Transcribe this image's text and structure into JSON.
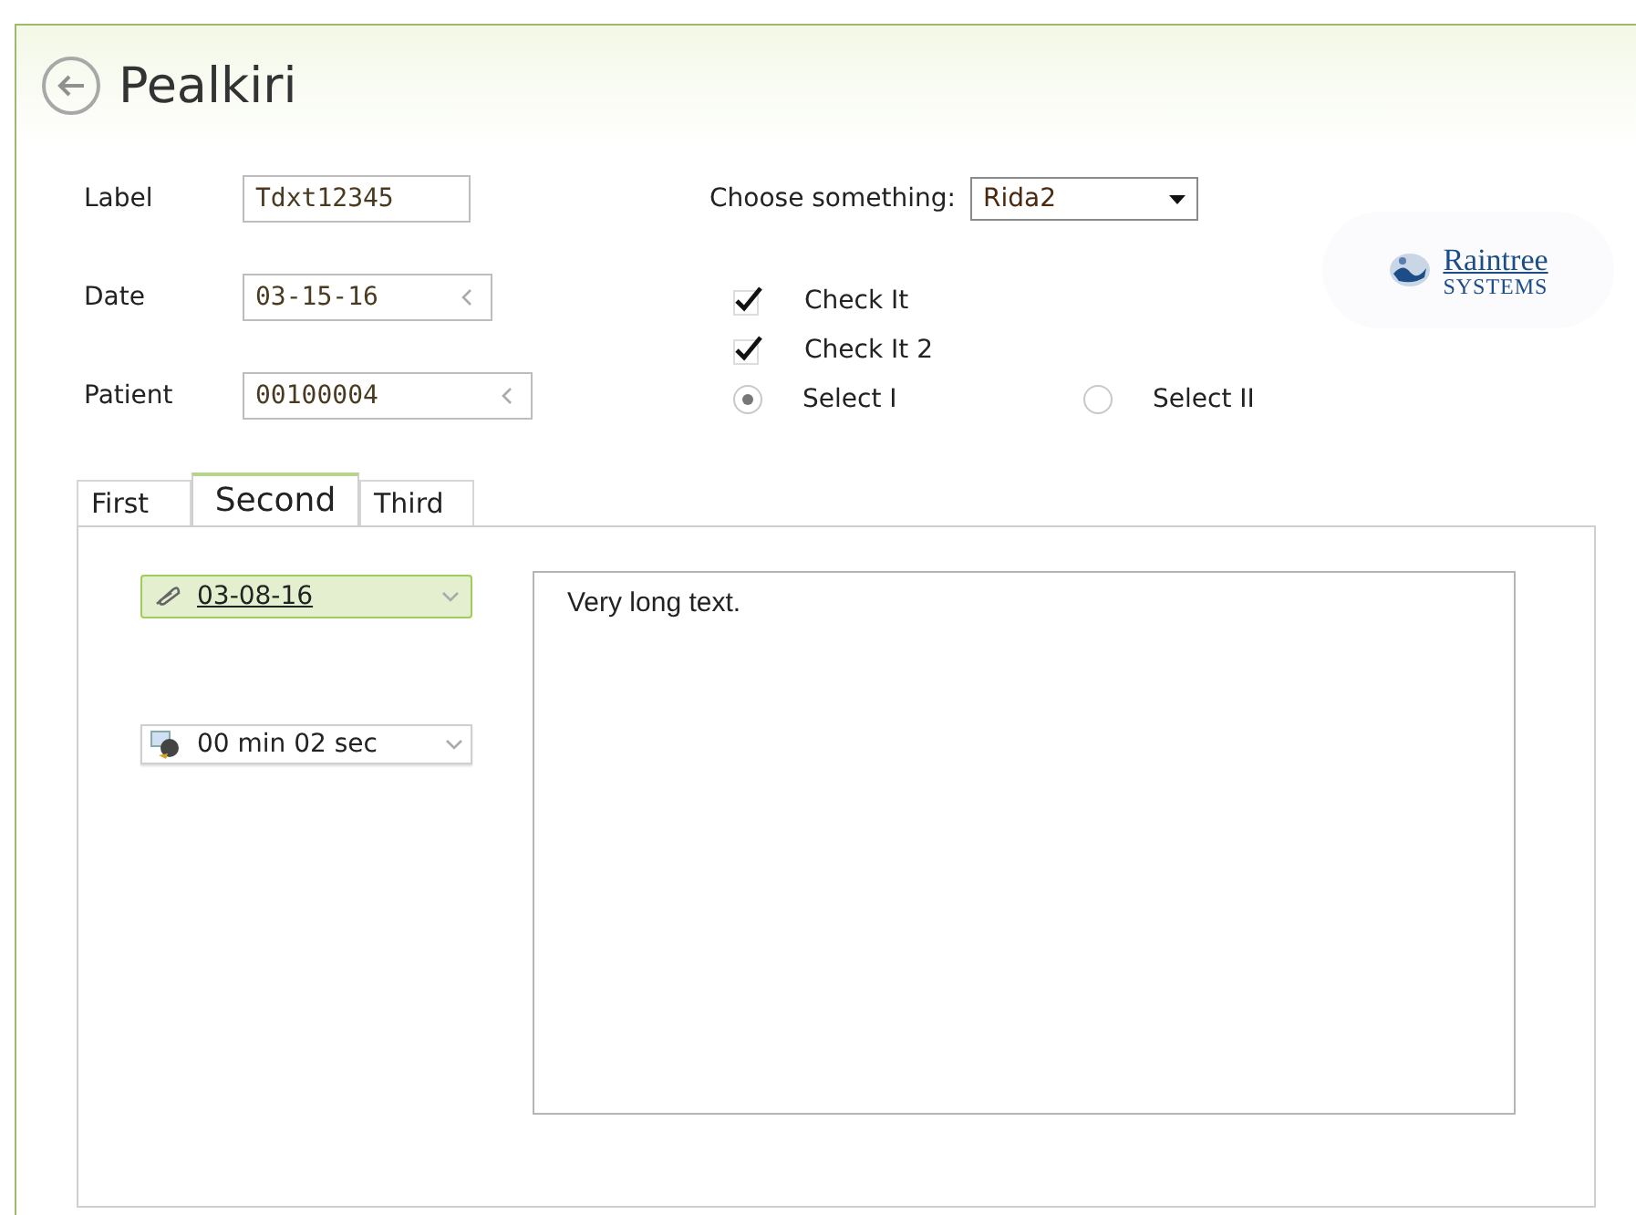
{
  "header": {
    "title": "Pealkiri"
  },
  "fields": [
    {
      "label": "Label",
      "value": "Tdxt12345",
      "kind": "text"
    },
    {
      "label": "Date",
      "value": "03-15-16",
      "kind": "picker"
    },
    {
      "label": "Patient",
      "value": "00100004",
      "kind": "picker"
    }
  ],
  "choice": {
    "label": "Choose something:",
    "value": "Rida2"
  },
  "checkboxes": [
    {
      "label": "Check It",
      "checked": true
    },
    {
      "label": "Check It 2",
      "checked": true
    }
  ],
  "radios": [
    {
      "label": "Select I",
      "selected": true
    },
    {
      "label": "Select II",
      "selected": false
    }
  ],
  "logo": {
    "name": "Raintree",
    "tagline": "SYSTEMS"
  },
  "tabs": [
    {
      "label": "First",
      "selected": false
    },
    {
      "label": "Second",
      "selected": true
    },
    {
      "label": "Third",
      "selected": false
    }
  ],
  "panel": {
    "date": "03-08-16",
    "duration": "00 min 02 sec",
    "notes": "Very long text."
  }
}
